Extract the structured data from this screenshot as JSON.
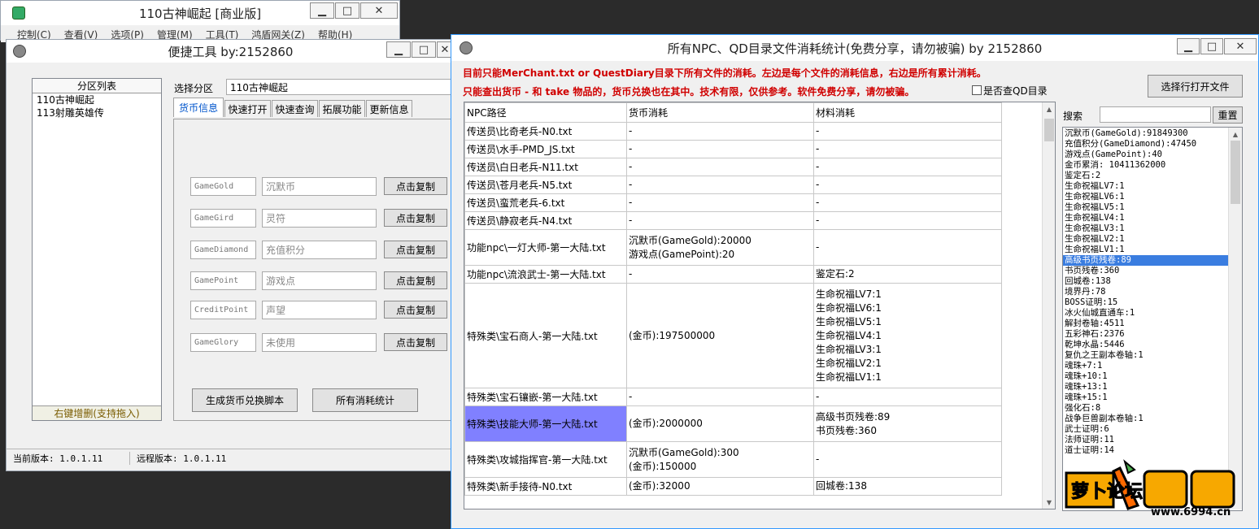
{
  "main_window": {
    "title": "110古神崛起 [商业版]",
    "menu": [
      "控制(C)",
      "查看(V)",
      "选项(P)",
      "管理(M)",
      "工具(T)",
      "鸿盾网关(Z)",
      "帮助(H)"
    ]
  },
  "quick_window": {
    "title": "便捷工具  by:2152860",
    "partition_list_header": "分区列表",
    "partitions": [
      "110古神崛起",
      "113射雕英雄传"
    ],
    "partition_footer": "右键增删(支持拖入)",
    "select_label": "选择分区",
    "select_value": "110古神崛起",
    "tabs": [
      "货币信息",
      "快速打开",
      "快速查询",
      "拓展功能",
      "更新信息"
    ],
    "currency_rows": [
      {
        "key": "GameGold",
        "name": "沉默币",
        "button": "点击复制"
      },
      {
        "key": "GameGird",
        "name": "灵符",
        "button": "点击复制"
      },
      {
        "key": "GameDiamond",
        "name": "充值积分",
        "button": "点击复制"
      },
      {
        "key": "GamePoint",
        "name": "游戏点",
        "button": "点击复制"
      },
      {
        "key": "CreditPoint",
        "name": "声望",
        "button": "点击复制"
      },
      {
        "key": "GameGlory",
        "name": "未使用",
        "button": "点击复制"
      }
    ],
    "gen_script_button": "生成货币兑换脚本",
    "all_stats_button": "所有消耗统计",
    "status_current": "当前版本: 1.0.1.11",
    "status_remote": "远程版本: 1.0.1.11"
  },
  "stats_window": {
    "title": "所有NPC、QD目录文件消耗统计(免费分享，请勿被骗)   by 2152860",
    "notice_line1": "目前只能MerChant.txt or QuestDiary目录下所有文件的消耗。左边是每个文件的消耗信息，右边是所有累计消耗。",
    "notice_line2": "只能查出货币 - 和 take 物品的，货币兑换也在其中。技术有限，仅供参考。软件免费分享，请勿被骗。",
    "checkbox_label": "是否查QD目录",
    "select_file_button": "选择行打开文件",
    "search_label": "搜索",
    "reset_button": "重置",
    "columns": [
      "NPC路径",
      "货币消耗",
      "材料消耗"
    ],
    "rows": [
      {
        "path": "传送员\\比奇老兵-N0.txt",
        "currency": [
          "-"
        ],
        "material": [
          "-"
        ]
      },
      {
        "path": "传送员\\水手-PMD_JS.txt",
        "currency": [
          "-"
        ],
        "material": [
          "-"
        ]
      },
      {
        "path": "传送员\\白日老兵-N11.txt",
        "currency": [
          "-"
        ],
        "material": [
          "-"
        ]
      },
      {
        "path": "传送员\\苍月老兵-N5.txt",
        "currency": [
          "-"
        ],
        "material": [
          "-"
        ]
      },
      {
        "path": "传送员\\蛮荒老兵-6.txt",
        "currency": [
          "-"
        ],
        "material": [
          "-"
        ]
      },
      {
        "path": "传送员\\静寂老兵-N4.txt",
        "currency": [
          "-"
        ],
        "material": [
          "-"
        ]
      },
      {
        "path": "功能npc\\一灯大师-第一大陆.txt",
        "currency": [
          "沉默币(GameGold):20000",
          "游戏点(GamePoint):20"
        ],
        "material": [
          "-"
        ]
      },
      {
        "path": "功能npc\\流浪武士-第一大陆.txt",
        "currency": [
          "-"
        ],
        "material": [
          "鉴定石:2"
        ]
      },
      {
        "path": "特殊类\\宝石商人-第一大陆.txt",
        "currency": [
          "(金币):197500000"
        ],
        "material": [
          "生命祝福LV7:1",
          "生命祝福LV6:1",
          "生命祝福LV5:1",
          "生命祝福LV4:1",
          "生命祝福LV3:1",
          "生命祝福LV2:1",
          "生命祝福LV1:1"
        ]
      },
      {
        "path": "特殊类\\宝石镶嵌-第一大陆.txt",
        "currency": [
          "-"
        ],
        "material": [
          "-"
        ]
      },
      {
        "path": "特殊类\\技能大师-第一大陆.txt",
        "currency": [
          "(金币):2000000"
        ],
        "material": [
          "高级书页残卷:89",
          "书页残卷:360"
        ]
      },
      {
        "path": "特殊类\\攻城指挥官-第一大陆.txt",
        "currency": [
          "沉默币(GameGold):300",
          "(金币):150000"
        ],
        "material": [
          "-"
        ]
      },
      {
        "path": "特殊类\\新手接待-N0.txt",
        "currency": [
          "(金币):32000"
        ],
        "material": [
          "回城卷:138"
        ]
      }
    ],
    "totals": [
      "沉默币(GameGold):91849300",
      "充值积分(GameDiamond):47450",
      "游戏点(GamePoint):40",
      "金币累消: 10411362000",
      "鉴定石:2",
      "生命祝福LV7:1",
      "生命祝福LV6:1",
      "生命祝福LV5:1",
      "生命祝福LV4:1",
      "生命祝福LV3:1",
      "生命祝福LV2:1",
      "生命祝福LV1:1",
      "高级书页残卷:89",
      "书页残卷:360",
      "回城卷:138",
      "境界丹:78",
      "BOSS证明:15",
      "冰火仙城直通车:1",
      "解封卷轴:4511",
      "五彩神石:2376",
      "乾坤水晶:5446",
      "复仇之王副本卷轴:1",
      "魂珠+7:1",
      "魂珠+10:1",
      "魂珠+13:1",
      "魂珠+15:1",
      "强化石:8",
      "战争巨兽副本卷轴:1",
      "武士证明:6",
      "法师证明:11",
      "道士证明:14"
    ]
  },
  "watermark": {
    "brand": "萝卜论坛",
    "url": "www.6994.cn"
  }
}
